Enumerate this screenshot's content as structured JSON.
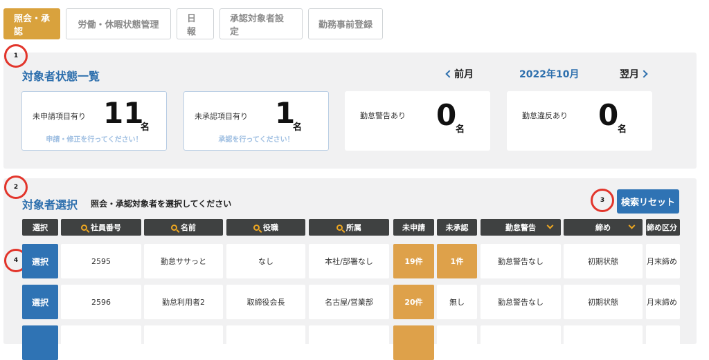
{
  "tabs": [
    {
      "label": "照会・承認",
      "active": true
    },
    {
      "label": "労働・休暇状態管理",
      "active": false
    },
    {
      "label": "日報",
      "active": false
    },
    {
      "label": "承認対象者設定",
      "active": false
    },
    {
      "label": "勤務事前登録",
      "active": false
    }
  ],
  "markers": [
    "1",
    "2",
    "3",
    "4"
  ],
  "status": {
    "title": "対象者状態一覧",
    "month_nav": {
      "prev": "前月",
      "current": "2022年10月",
      "next": "翌月"
    },
    "cards": [
      {
        "label": "未申請項目有り",
        "count": "11",
        "unit": "名",
        "hint": "申請・修正を行ってください！"
      },
      {
        "label": "未承認項目有り",
        "count": "1",
        "unit": "名",
        "hint": "承認を行ってください！"
      },
      {
        "label": "勤怠警告あり",
        "count": "0",
        "unit": "名",
        "hint": ""
      },
      {
        "label": "勤怠違反あり",
        "count": "0",
        "unit": "名",
        "hint": ""
      }
    ]
  },
  "selection": {
    "title": "対象者選択",
    "subtitle": "照会・承認対象者を選択してください",
    "reset_label": "検索リセット",
    "columns": [
      "選択",
      "社員番号",
      "名前",
      "役職",
      "所属",
      "未申請",
      "未承認",
      "勤怠警告",
      "締め",
      "締め区分"
    ],
    "rows": [
      {
        "select": "選択",
        "id": "2595",
        "name": "勤怠ササっと",
        "role": "なし",
        "dept": "本社/部署なし",
        "unapplied": "19件",
        "unapproved": "1件",
        "warning": "勤怠警告なし",
        "closing": "初期状態",
        "closing_type": "月末締め"
      },
      {
        "select": "選択",
        "id": "2596",
        "name": "勤怠利用者2",
        "role": "取締役会長",
        "dept": "名古屋/営業部",
        "unapplied": "20件",
        "unapproved": "無し",
        "warning": "勤怠警告なし",
        "closing": "初期状態",
        "closing_type": "月末締め"
      },
      {
        "select": "",
        "id": "",
        "name": "",
        "role": "",
        "dept": "",
        "unapplied": "",
        "unapproved": "",
        "warning": "",
        "closing": "",
        "closing_type": ""
      }
    ]
  },
  "colors": {
    "accent_orange": "#d9a23d",
    "primary_blue": "#2f73b4",
    "header_dark": "#3f4141",
    "title_blue": "#2d6fad"
  }
}
